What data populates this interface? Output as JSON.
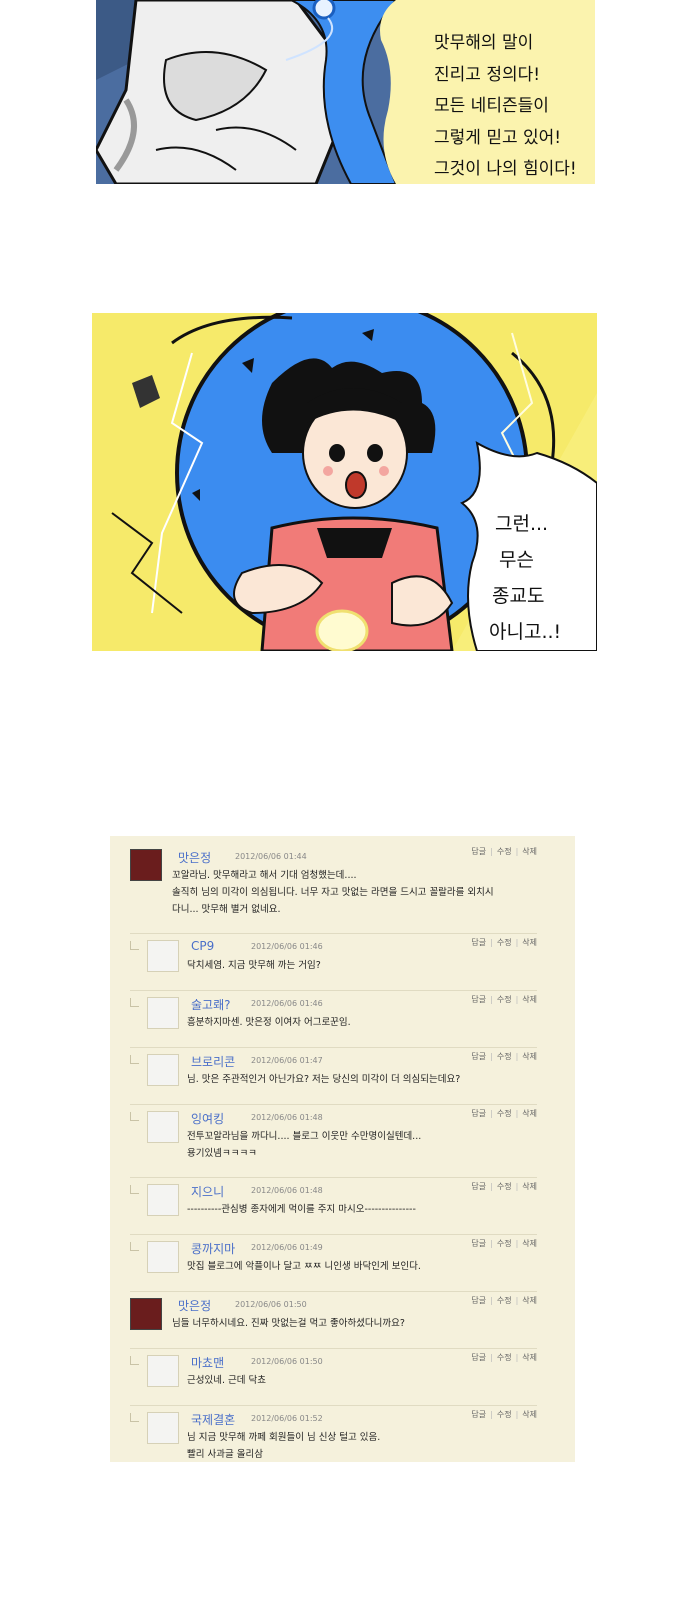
{
  "panel1": {
    "lines": [
      "맛무해의 말이",
      "진리고 정의다!",
      "모든 네티즌들이",
      "그렇게 믿고 있어!",
      "그것이 나의 힘이다!"
    ]
  },
  "panel2": {
    "lines": [
      "그런...",
      "무슨",
      "종교도",
      "아니고..!"
    ]
  },
  "actions": {
    "reply": "답글",
    "edit": "수정",
    "delete": "삭제"
  },
  "comments": [
    {
      "name": "맛은정",
      "time": "2012/06/06 01:44",
      "reply": false,
      "avatar": "photo",
      "lines": [
        "꼬알라님. 맛무해라고 해서 기대 엄청했는데....",
        "솔직히 님의 미각이 의심됩니다. 너무 자고 맛없는 라면을 드시고 꼴랄라를 외치시",
        "다니... 맛무해 별거 없네요."
      ]
    },
    {
      "name": "CP9",
      "time": "2012/06/06 01:46",
      "reply": true,
      "avatar": "default",
      "lines": [
        "닥치세염. 지금 맛무해 까는 거임?"
      ]
    },
    {
      "name": "술고뢔?",
      "time": "2012/06/06 01:46",
      "reply": true,
      "avatar": "default",
      "lines": [
        "흥분하지마센. 맛은정 이여자 어그로꾼임."
      ]
    },
    {
      "name": "브로리콘",
      "time": "2012/06/06 01:47",
      "reply": true,
      "avatar": "default",
      "lines": [
        "님. 맛은 주관적인거 아닌가요? 저는 당신의 미각이 더 의심되는데요?"
      ]
    },
    {
      "name": "잉여킹",
      "time": "2012/06/06 01:48",
      "reply": true,
      "avatar": "default",
      "lines": [
        "전투꼬알라님을 까다니.... 블로그 이웃만 수만명이실텐데...",
        "용기있넴ㅋㅋㅋㅋ"
      ]
    },
    {
      "name": "지으니",
      "time": "2012/06/06 01:48",
      "reply": true,
      "avatar": "default",
      "lines": [
        "----------관심병 종자에게 먹이를 주지 마시오---------------"
      ]
    },
    {
      "name": "콩까지마",
      "time": "2012/06/06 01:49",
      "reply": true,
      "avatar": "default",
      "lines": [
        "맛집 블로그에 악플이나 달고 ㅉㅉ 니인생 바닥인게 보인다."
      ]
    },
    {
      "name": "맛은정",
      "time": "2012/06/06 01:50",
      "reply": false,
      "avatar": "photo",
      "lines": [
        "님들 너무하시네요. 진짜 맛없는걸 먹고 좋아하셨다니까요?"
      ]
    },
    {
      "name": "마쵸맨",
      "time": "2012/06/06 01:50",
      "reply": true,
      "avatar": "default",
      "lines": [
        "근성있네. 근데 닥쵸"
      ]
    },
    {
      "name": "국제결혼",
      "time": "2012/06/06 01:52",
      "reply": true,
      "avatar": "default",
      "lines": [
        "님 지금 맛무해 까페 회원들이 님 신상 털고 있음.",
        "빨리 사과글 올리삼"
      ]
    }
  ]
}
